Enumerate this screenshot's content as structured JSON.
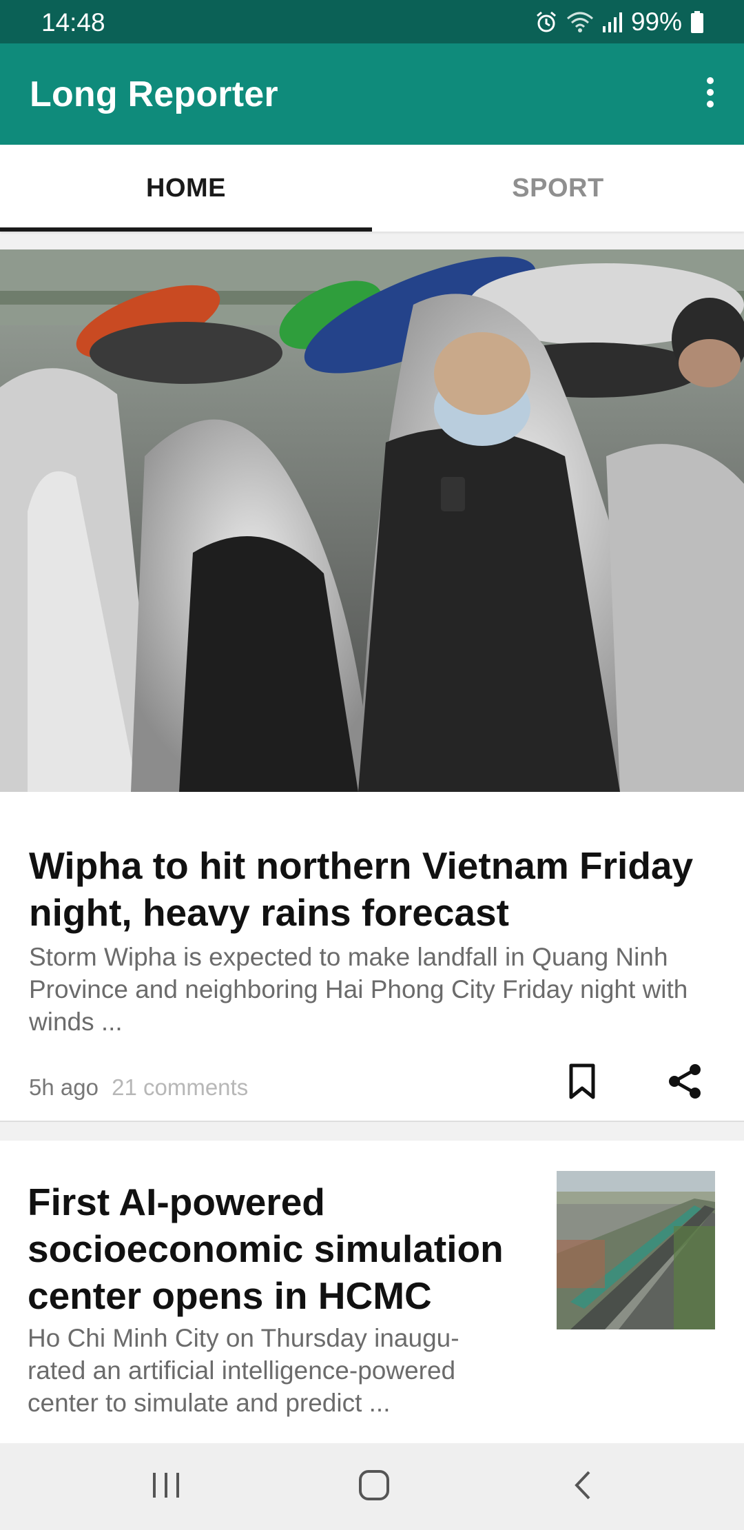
{
  "status_bar": {
    "time": "14:48",
    "battery": "99%",
    "icons": [
      "alarm-icon",
      "wifi-icon",
      "signal-icon",
      "battery-icon"
    ]
  },
  "app_bar": {
    "title": "Long Reporter",
    "menu_icon": "more-vert-icon"
  },
  "tabs": [
    {
      "label": "HOME",
      "selected": true
    },
    {
      "label": "SPORT",
      "selected": false
    }
  ],
  "articles": [
    {
      "image": "rain-crowd-photo",
      "title": "Wipha to hit northern Vietnam Friday night, heavy rains forecast",
      "summary": "Storm Wipha is expected to make landfall in Quang Ninh Province and neighboring Hai Phong City Friday night with winds ...",
      "age": "5h ago",
      "comments": "21 comments",
      "actions": [
        "bookmark-icon",
        "share-icon"
      ]
    },
    {
      "image": "city-highway-photo",
      "title": "First AI-powered socioeconomic simulation center opens in HCMC",
      "summary": "Ho Chi Minh City on Thursday inaugu-rated an artificial intelligence-powered center to simulate and predict ..."
    }
  ],
  "nav_bar": {
    "icons": [
      "recents-icon",
      "home-icon",
      "back-icon"
    ]
  },
  "colors": {
    "status_bar": "#0b6156",
    "app_bar": "#0f8b7b",
    "tab_active": "#1a1a1a",
    "tab_inactive": "#8f8f8f"
  }
}
